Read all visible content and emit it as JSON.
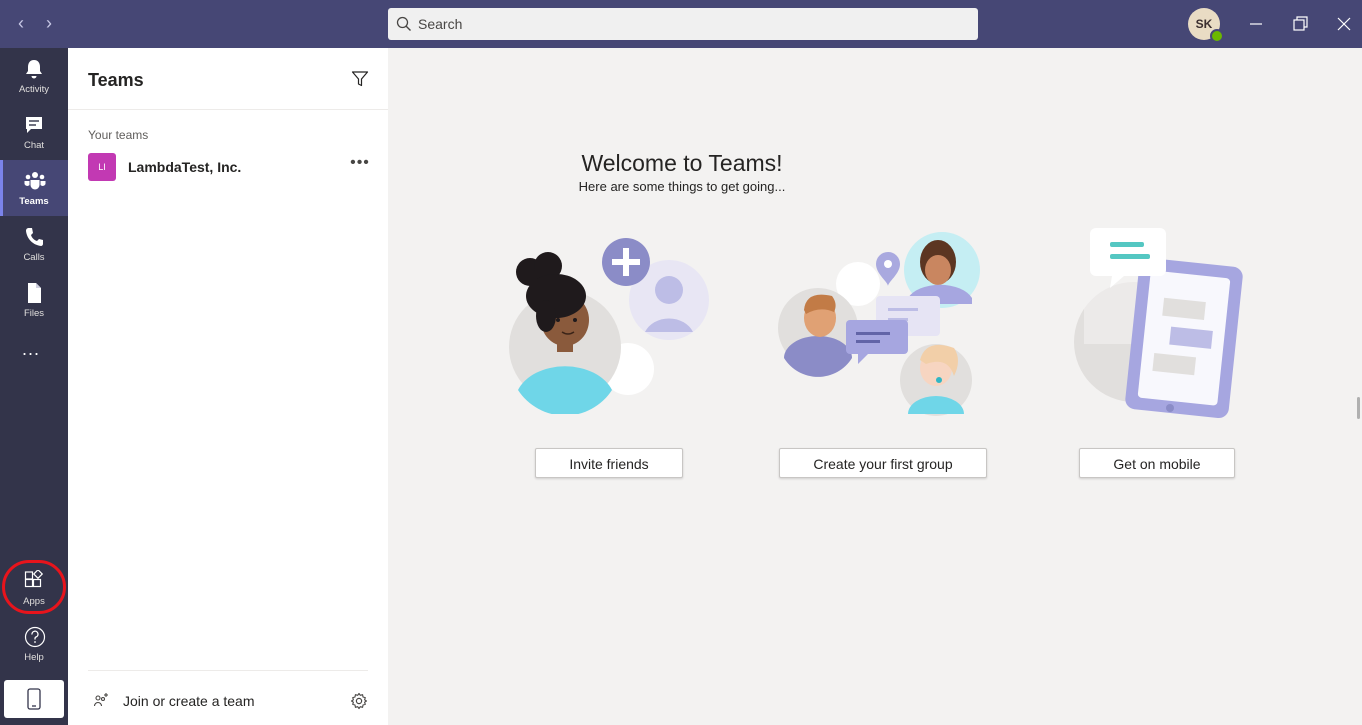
{
  "titlebar": {
    "search_placeholder": "Search",
    "user_initials": "SK"
  },
  "rail": {
    "items": [
      {
        "label": "Activity",
        "icon": "bell-icon"
      },
      {
        "label": "Chat",
        "icon": "chat-icon"
      },
      {
        "label": "Teams",
        "icon": "teams-icon"
      },
      {
        "label": "Calls",
        "icon": "phone-icon"
      },
      {
        "label": "Files",
        "icon": "file-icon"
      }
    ],
    "more_label": "...",
    "apps_label": "Apps",
    "help_label": "Help",
    "active_item": "Teams"
  },
  "panel": {
    "title": "Teams",
    "section_label": "Your teams",
    "teams": [
      {
        "initials": "LI",
        "name": "LambdaTest, Inc."
      }
    ],
    "join_label": "Join or create a team"
  },
  "main": {
    "title": "Welcome to Teams!",
    "subtitle": "Here are some things to get going...",
    "actions": [
      {
        "label": "Invite friends"
      },
      {
        "label": "Create your first group"
      },
      {
        "label": "Get on mobile"
      }
    ]
  },
  "colors": {
    "titlebar": "#464775",
    "rail": "#33344a",
    "accent": "#7b83eb",
    "apps_highlight": "#e8141c"
  }
}
